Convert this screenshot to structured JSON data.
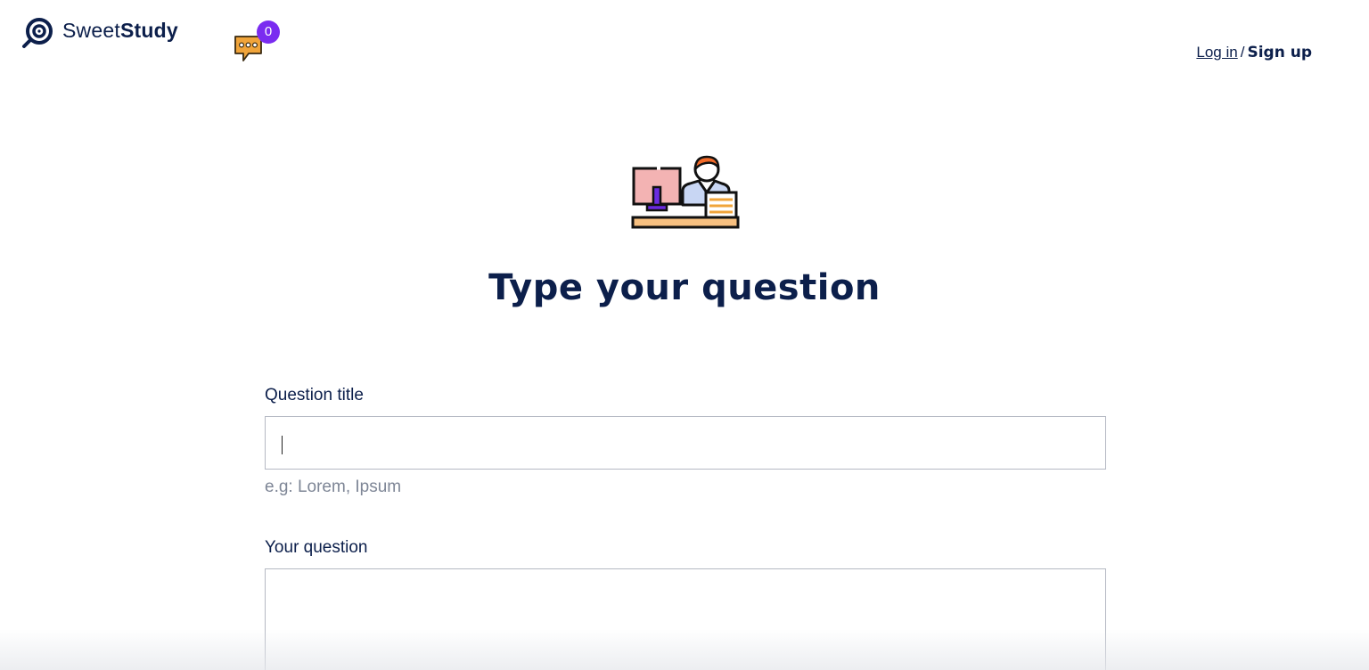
{
  "header": {
    "logo": {
      "text_light": "Sweet",
      "text_bold": "Study",
      "icon": "lollipop-logo-icon",
      "color": "#0c1f4b"
    },
    "chat": {
      "icon": "chat-bubble-icon",
      "badge_count": "0",
      "badge_color": "#7a2cf0",
      "icon_color": "#f0a43a"
    },
    "auth": {
      "login_label": "Log in",
      "separator": "/",
      "signup_label": "Sign up"
    }
  },
  "hero": {
    "illustration": "person-at-computer-icon",
    "title": "Type your question"
  },
  "form": {
    "title_field": {
      "label": "Question title",
      "value": "",
      "hint": "e.g: Lorem, Ipsum"
    },
    "question_field": {
      "label": "Your question",
      "value": ""
    }
  },
  "colors": {
    "primary_text": "#0c1f4b",
    "hint_text": "#7e8696",
    "border": "#b5b9c3",
    "badge": "#7a2cf0"
  }
}
